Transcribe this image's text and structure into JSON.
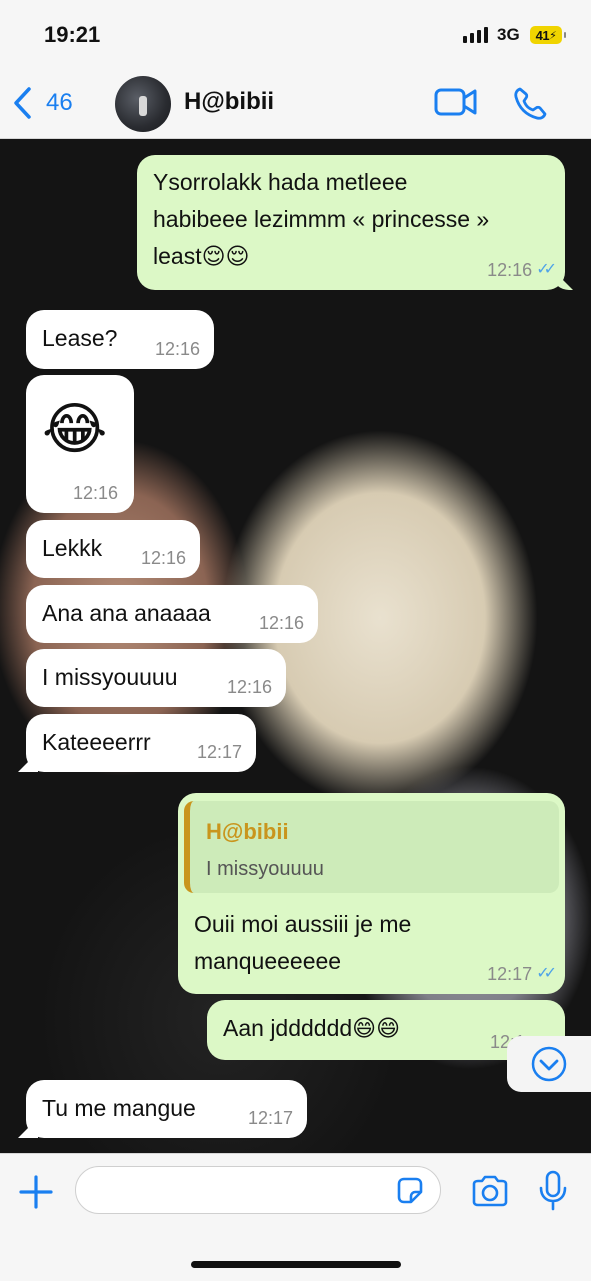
{
  "status_bar": {
    "time": "19:21",
    "network": "3G",
    "battery": "41"
  },
  "header": {
    "back_count": "46",
    "contact_name": "H@bibii"
  },
  "messages": [
    {
      "text": "Ysorrolakk hada metleee\nhabibeee lezimmm « princesse »\nleast😌😌",
      "time": "12:16"
    },
    {
      "text": "Lease?",
      "time": "12:16"
    },
    {
      "text": "😂",
      "time": "12:16"
    },
    {
      "text": "Lekkk",
      "time": "12:16"
    },
    {
      "text": "Ana ana anaaaa",
      "time": "12:16"
    },
    {
      "text": "I missyouuuu",
      "time": "12:16"
    },
    {
      "text": "Kateeeerrr",
      "time": "12:17"
    },
    {
      "reply_name": "H@bibii",
      "reply_text": "I missyouuuu",
      "text": "Ouii moi aussiii je me\nmanqueeeeee",
      "time": "12:17"
    },
    {
      "text": "Aan jdddddd😄😄",
      "time": "12:1"
    },
    {
      "text": "Tu me mangue",
      "time": "12:17"
    }
  ],
  "icons": {
    "back": "chevron-left-icon",
    "video": "video-call-icon",
    "phone": "phone-icon",
    "scroll": "chevron-down-circle-icon",
    "plus": "plus-icon",
    "sticker": "sticker-icon",
    "camera": "camera-icon",
    "mic": "microphone-icon"
  },
  "colors": {
    "accent": "#1a7ff0",
    "outgoing_bubble": "#dcf8c6",
    "incoming_bubble": "#ffffff",
    "reply_name": "#c9951d",
    "read_ticks": "#4fa3e8"
  },
  "composer": {
    "value": ""
  }
}
